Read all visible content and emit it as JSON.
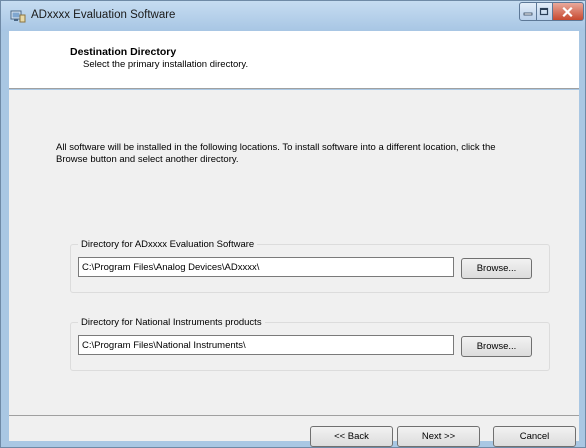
{
  "window": {
    "title": "ADxxxx Evaluation  Software",
    "controls": {
      "minimize": "minimize",
      "maximize": "maximize",
      "close": "close"
    }
  },
  "header": {
    "title": "Destination Directory",
    "subtitle": "Select the primary installation directory."
  },
  "body": {
    "description": "All software will be installed in the following locations. To install software into a different location, click the Browse button and select another directory.",
    "groups": [
      {
        "label": "Directory for ADxxxx Evaluation  Software",
        "path": "C:\\Program Files\\Analog Devices\\ADxxxx\\",
        "browse_label": "Browse..."
      },
      {
        "label": "Directory for National Instruments products",
        "path": "C:\\Program Files\\National Instruments\\",
        "browse_label": "Browse..."
      }
    ]
  },
  "footer": {
    "back_label": "<< Back",
    "next_label": "Next >>",
    "cancel_label": "Cancel"
  },
  "colors": {
    "titlebar": "#a8c6e4",
    "panel": "#f0f0f0",
    "close_button": "#c7492f"
  }
}
